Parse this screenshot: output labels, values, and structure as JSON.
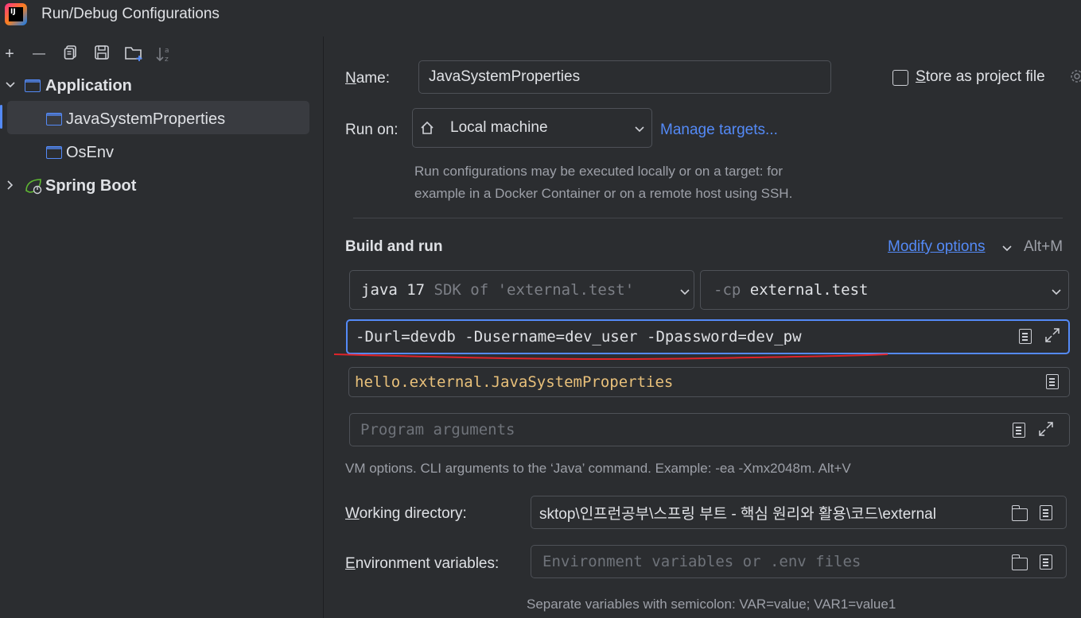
{
  "window": {
    "title": "Run/Debug Configurations",
    "logo_text": "IJ"
  },
  "toolbar": {
    "add": "+",
    "remove": "—",
    "copy": "⧉",
    "save": "🖫",
    "folder": "📁",
    "sort": "↓ª"
  },
  "tree": {
    "application": {
      "label": "Application",
      "expanded": true
    },
    "items": [
      {
        "label": "JavaSystemProperties",
        "selected": true
      },
      {
        "label": "OsEnv",
        "selected": false
      }
    ],
    "spring_boot": {
      "label": "Spring Boot",
      "expanded": false
    }
  },
  "form": {
    "name_label": "Name:",
    "name_value": "JavaSystemProperties",
    "store_as_project_file": "Store as project file",
    "run_on_label": "Run on:",
    "run_on_value": "Local machine",
    "manage_targets": "Manage targets...",
    "run_on_hint_1": "Run configurations may be executed locally or on a target: for",
    "run_on_hint_2": "example in a Docker Container or on a remote host using SSH.",
    "build_and_run": "Build and run",
    "modify_options": "Modify options",
    "modify_options_shortcut": "Alt+M",
    "jdk_main": "java 17",
    "jdk_detail": "SDK of 'external.test'",
    "cp_flag": "-cp",
    "cp_value": "external.test",
    "vm_options": "-Durl=devdb -Dusername=dev_user -Dpassword=dev_pw",
    "main_class": "hello.external.JavaSystemProperties",
    "program_args_placeholder": "Program arguments",
    "vm_hint": "VM options. CLI arguments to the ‘Java’ command. Example: -ea -Xmx2048m. Alt+V",
    "working_dir_label": "Working directory:",
    "working_dir_value": "sktop\\인프런공부\\스프링 부트 - 핵심 원리와 활용\\코드\\external",
    "env_label": "Environment variables:",
    "env_placeholder": "Environment variables or .env files",
    "env_hint": "Separate variables with semicolon: VAR=value; VAR1=value1"
  },
  "colors": {
    "background": "#2b2d30",
    "accent": "#548af7",
    "main_class": "#e8c07a",
    "annotation": "#e0242a"
  }
}
